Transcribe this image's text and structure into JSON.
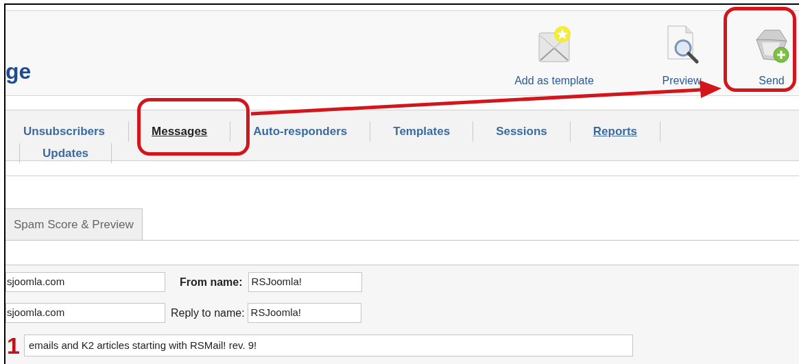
{
  "page_title": "ge",
  "toolbar": [
    {
      "kind": "template",
      "label": "Add as template"
    },
    {
      "kind": "preview",
      "label": "Preview"
    },
    {
      "kind": "send",
      "label": "Send"
    }
  ],
  "nav": {
    "rows": [
      [
        {
          "label": "Unsubscribers",
          "selected": false,
          "underlined": false
        },
        {
          "label": "Messages",
          "selected": true,
          "underlined": true
        },
        {
          "label": "Auto-responders",
          "selected": false,
          "underlined": false
        },
        {
          "label": "Templates",
          "selected": false,
          "underlined": false
        },
        {
          "label": "Sessions",
          "selected": false,
          "underlined": false
        },
        {
          "label": "Reports",
          "selected": false,
          "underlined": true
        }
      ],
      [
        {
          "label": "Updates",
          "selected": false,
          "underlined": false
        }
      ]
    ]
  },
  "tabs": [
    {
      "label": "Spam Score & Preview",
      "selected": false
    }
  ],
  "sender_rows": [
    {
      "email": "sjoomla.com",
      "label": "From name:",
      "required": true,
      "name": "RSJoomla!"
    },
    {
      "email": "sjoomla.com",
      "label": "Reply to name:",
      "required": false,
      "name": "RSJoomla!"
    }
  ],
  "subject": "emails and K2 articles starting with RSMail! rev. 9!",
  "annotations": {
    "step_number": "1"
  }
}
